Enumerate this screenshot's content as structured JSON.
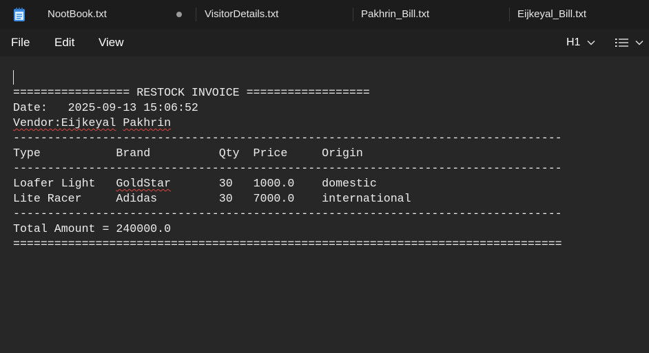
{
  "tabs": [
    {
      "label": "NootBook.txt",
      "unsaved": true
    },
    {
      "label": "VisitorDetails.txt"
    },
    {
      "label": "Pakhrin_Bill.txt"
    },
    {
      "label": "Eijkeyal_Bill.txt"
    }
  ],
  "menu": {
    "file": "File",
    "edit": "Edit",
    "view": "View"
  },
  "format": {
    "heading": "H1"
  },
  "document": {
    "header_rule": "================= RESTOCK INVOICE ==================",
    "date_label": "Date:   ",
    "date_value": "2025-09-13 15:06:52",
    "vendor_label": "Vendor:",
    "vendor_first": "Eijkeyal",
    "vendor_last": "Pakhrin",
    "dash_rule": "--------------------------------------------------------------------------------",
    "columns": {
      "type": "Type           ",
      "brand": "Brand          ",
      "qty": "Qty  ",
      "price": "Price     ",
      "origin": "Origin"
    },
    "rows": [
      {
        "type": "Loafer Light   ",
        "brand": "GoldStar",
        "brand_pad": "       ",
        "qty": "30   ",
        "price": "1000.0    ",
        "origin": "domestic"
      },
      {
        "type": "Lite Racer     ",
        "brand": "Adidas",
        "brand_pad": "         ",
        "qty": "30   ",
        "price": "7000.0    ",
        "origin": "international"
      }
    ],
    "total": "Total Amount = 240000.0",
    "footer_rule": "================================================================================"
  }
}
